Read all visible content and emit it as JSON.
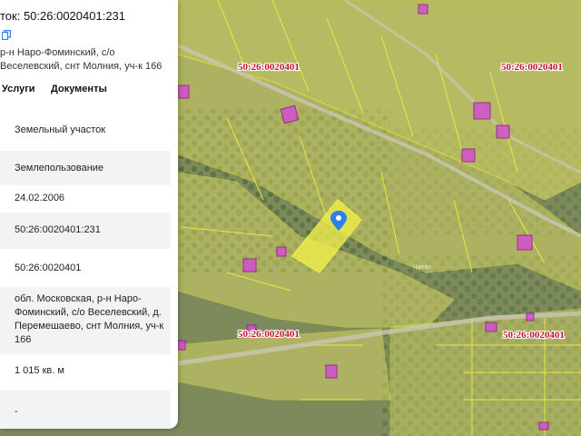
{
  "panel": {
    "title": "ток: 50:26:0020401:231",
    "address": "р-н Наро-Фоминский, с/о Веселевский, снт Молния, уч-к 166",
    "tabs": [
      "Услуги",
      "Документы"
    ],
    "fields": [
      "Земельный участок",
      "Землепользование",
      "24.02.2006",
      "50:26:0020401:231",
      "50:26:0020401",
      "обл. Московская, р-н Наро-Фоминский, с/о Веселевский, д. Перемешаево, снт Молния, уч-к 166",
      "1 015 кв. м",
      "-"
    ]
  },
  "map": {
    "quarter_labels": [
      "50:26:0020401",
      "50:26:0020401",
      "50:26:0020401",
      "50:26:0020401"
    ],
    "road_label": "Чаево",
    "colors": {
      "parcel_fill": "#e6e36a",
      "parcel_border": "#f1ef3e",
      "building": "#d24fd0",
      "label_red": "#c4162a",
      "pin": "#2f80ed"
    },
    "pin_icon": "location-pin-icon"
  }
}
